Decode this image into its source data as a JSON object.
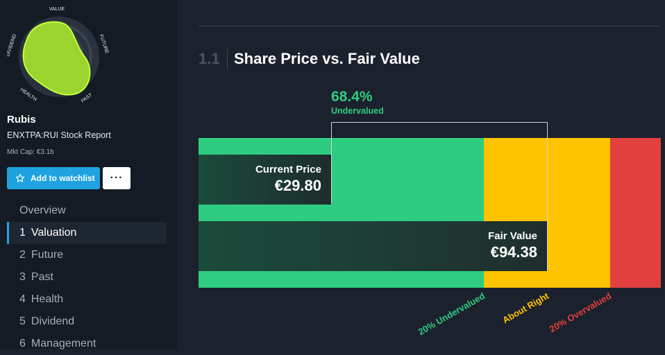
{
  "snowflake": {
    "labels": {
      "top": "VALUE",
      "right": "FUTURE",
      "bottom_right": "PAST",
      "bottom_left": "HEALTH",
      "left": "DIVIDEND"
    },
    "fill_color": "#a6e22e"
  },
  "company": {
    "name": "Rubis",
    "report": "ENXTPA:RUI Stock Report",
    "mkt_cap": "Mkt Cap: €3.1b"
  },
  "actions": {
    "watchlist_label": "Add to watchlist",
    "watchlist_icon": "star-icon",
    "more_label": "···"
  },
  "nav": {
    "items": [
      {
        "num": "",
        "label": "Overview",
        "active": false
      },
      {
        "num": "1",
        "label": "Valuation",
        "active": true
      },
      {
        "num": "2",
        "label": "Future",
        "active": false
      },
      {
        "num": "3",
        "label": "Past",
        "active": false
      },
      {
        "num": "4",
        "label": "Health",
        "active": false
      },
      {
        "num": "5",
        "label": "Dividend",
        "active": false
      },
      {
        "num": "6",
        "label": "Management",
        "active": false
      }
    ]
  },
  "section": {
    "number": "1.1",
    "title": "Share Price vs. Fair Value"
  },
  "valuation": {
    "discount_pct": "68.4%",
    "discount_label": "Undervalued",
    "current_price_label": "Current Price",
    "current_price": "€29.80",
    "fair_value_label": "Fair Value",
    "fair_value": "€94.38",
    "zones": {
      "undervalued": "20% Undervalued",
      "about_right": "About Right",
      "overvalued": "20% Overvalued"
    },
    "colors": {
      "green": "#2ecc81",
      "yellow": "#ffc400",
      "red": "#e2403f"
    }
  }
}
